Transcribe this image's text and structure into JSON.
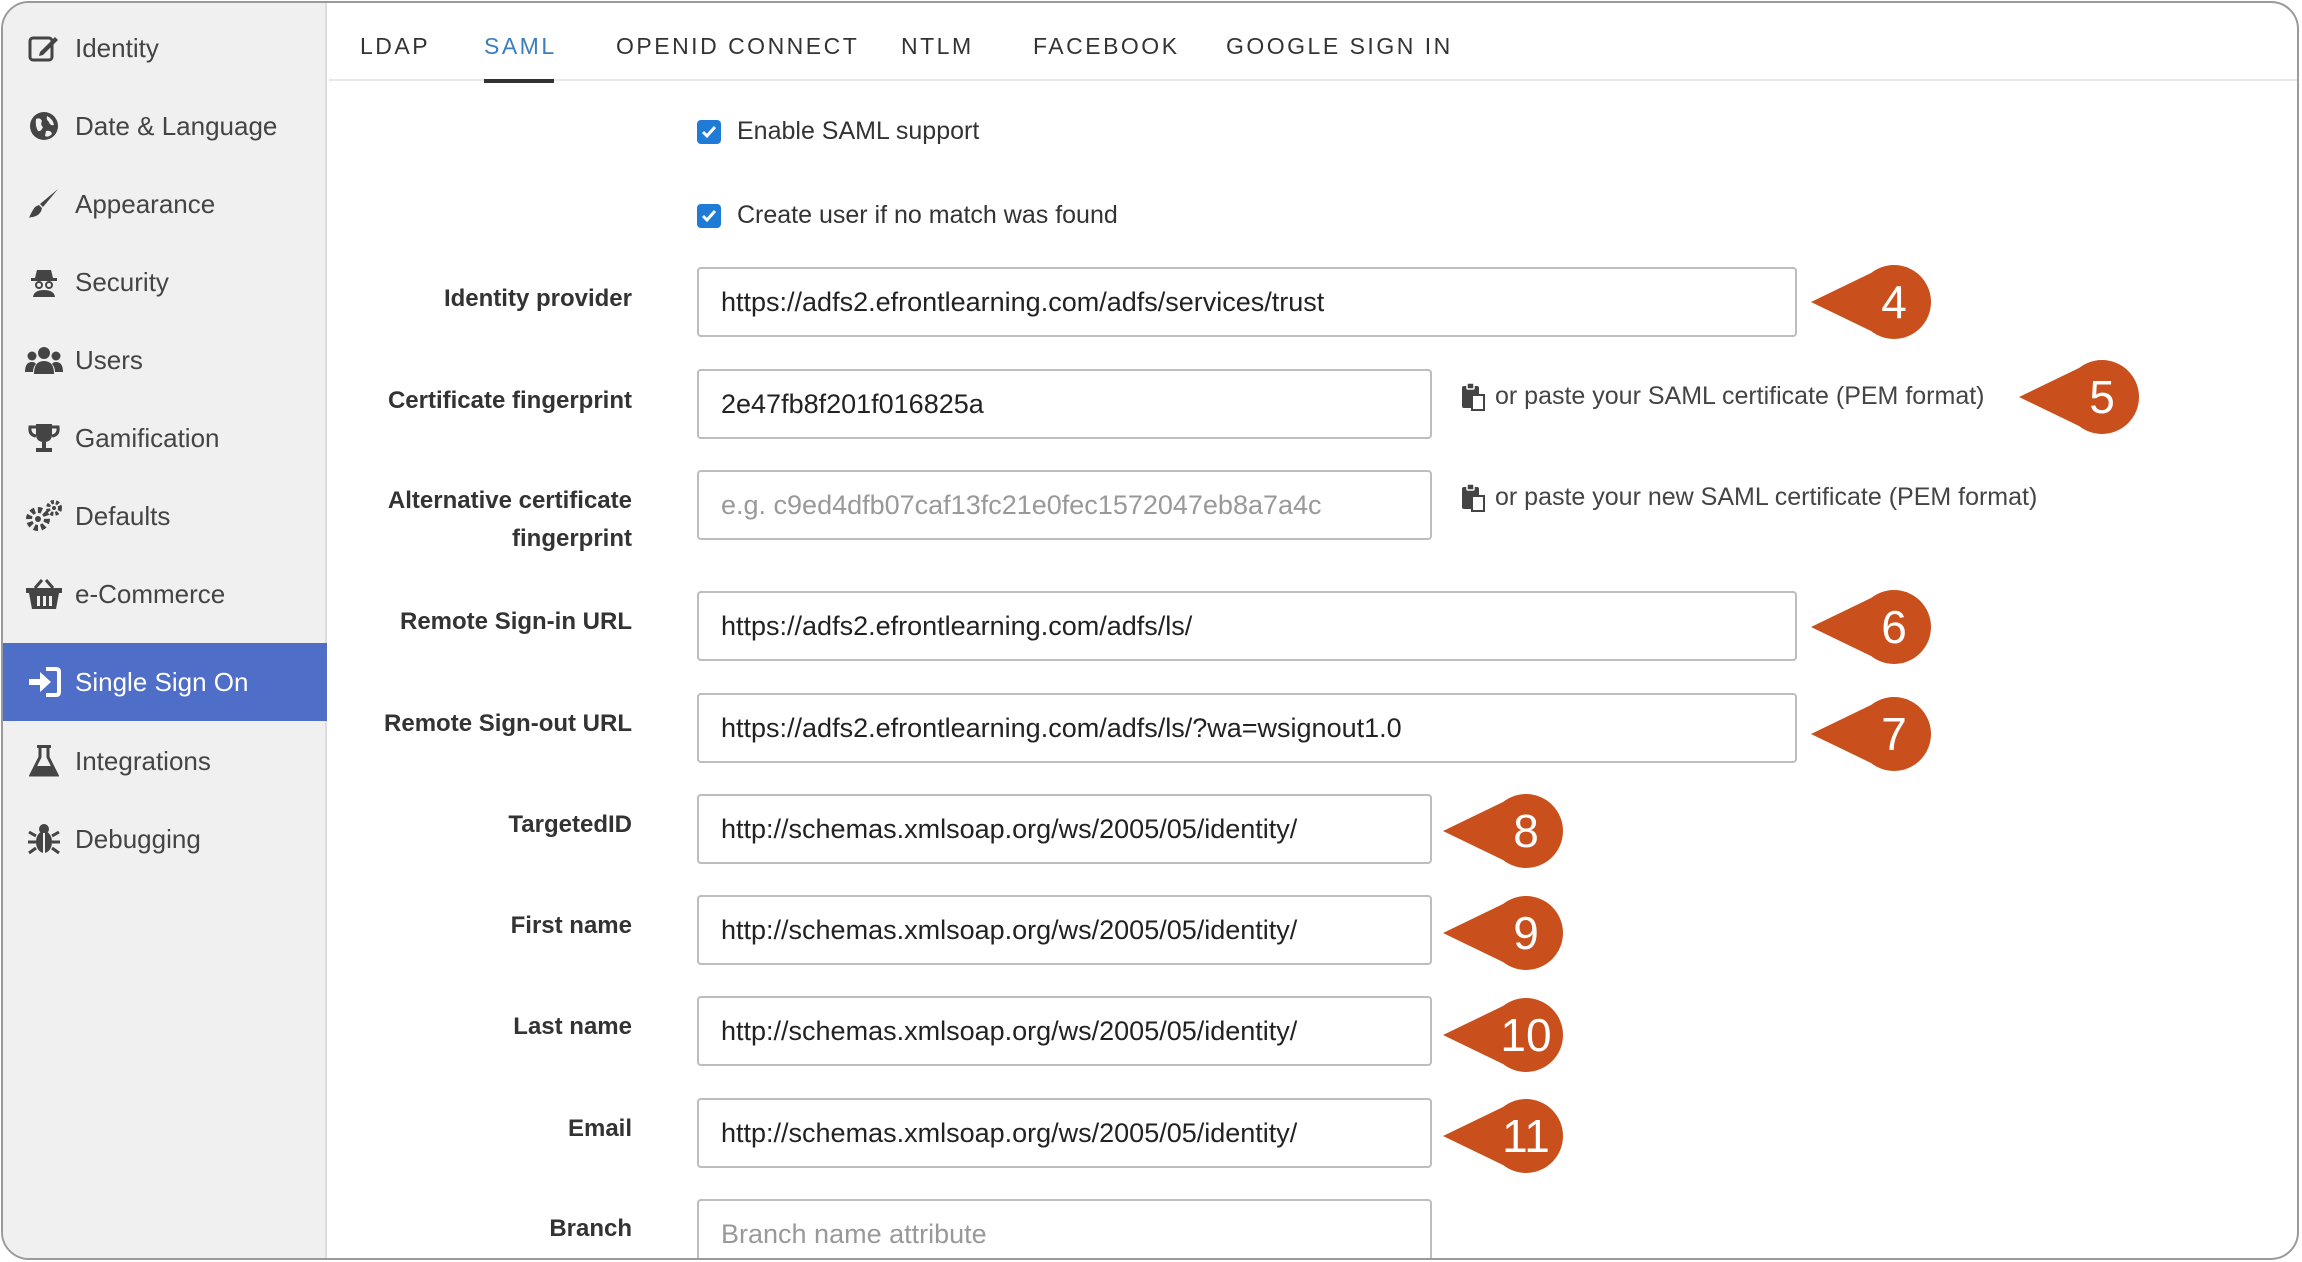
{
  "sidebar": {
    "items": [
      {
        "label": "Identity",
        "icon": "edit-icon"
      },
      {
        "label": "Date & Language",
        "icon": "globe-icon"
      },
      {
        "label": "Appearance",
        "icon": "paintbrush-icon"
      },
      {
        "label": "Security",
        "icon": "spy-icon"
      },
      {
        "label": "Users",
        "icon": "users-icon"
      },
      {
        "label": "Gamification",
        "icon": "trophy-icon"
      },
      {
        "label": "Defaults",
        "icon": "gears-icon"
      },
      {
        "label": "e-Commerce",
        "icon": "basket-icon"
      },
      {
        "label": "Single Sign On",
        "icon": "sign-in-icon",
        "active": true
      },
      {
        "label": "Integrations",
        "icon": "flask-icon"
      },
      {
        "label": "Debugging",
        "icon": "bug-icon"
      }
    ]
  },
  "tabs": [
    {
      "label": "LDAP"
    },
    {
      "label": "SAML",
      "active": true
    },
    {
      "label": "OPENID CONNECT"
    },
    {
      "label": "NTLM"
    },
    {
      "label": "FACEBOOK"
    },
    {
      "label": "GOOGLE SIGN IN"
    }
  ],
  "form": {
    "enable_saml": {
      "label": "Enable SAML support",
      "checked": true
    },
    "create_user": {
      "label": "Create user if no match was found",
      "checked": true
    },
    "identity_provider": {
      "label": "Identity provider",
      "value": "https://adfs2.efrontlearning.com/adfs/services/trust"
    },
    "cert_fingerprint": {
      "label": "Certificate fingerprint",
      "value": "2e47fb8f201f016825a",
      "paste_link": "or paste your SAML certificate (PEM format)"
    },
    "alt_cert_fingerprint": {
      "label_line1": "Alternative certificate",
      "label_line2": "fingerprint",
      "placeholder": "e.g. c9ed4dfb07caf13fc21e0fec1572047eb8a7a4c",
      "paste_link": "or paste your new SAML certificate (PEM format)"
    },
    "remote_signin": {
      "label": "Remote Sign-in URL",
      "value": "https://adfs2.efrontlearning.com/adfs/ls/"
    },
    "remote_signout": {
      "label": "Remote Sign-out URL",
      "value": "https://adfs2.efrontlearning.com/adfs/ls/?wa=wsignout1.0"
    },
    "targeted_id": {
      "label": "TargetedID",
      "value": "http://schemas.xmlsoap.org/ws/2005/05/identity/"
    },
    "first_name": {
      "label": "First name",
      "value": "http://schemas.xmlsoap.org/ws/2005/05/identity/"
    },
    "last_name": {
      "label": "Last name",
      "value": "http://schemas.xmlsoap.org/ws/2005/05/identity/"
    },
    "email": {
      "label": "Email",
      "value": "http://schemas.xmlsoap.org/ws/2005/05/identity/"
    },
    "branch": {
      "label": "Branch",
      "placeholder": "Branch name attribute"
    }
  },
  "markers": [
    "4",
    "5",
    "6",
    "7",
    "8",
    "9",
    "10",
    "11"
  ],
  "colors": {
    "accent": "#4f6ec7",
    "marker": "#c9501c",
    "checkbox": "#1e7bd6",
    "active_tab": "#3c7dbf"
  }
}
